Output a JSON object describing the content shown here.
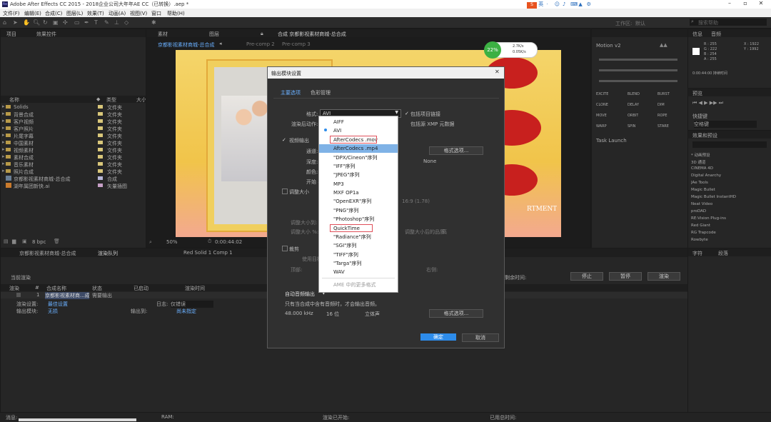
{
  "window": {
    "title": "Adobe After Effects CC 2015 - 2018企业公司大年年AE CC（已转换）.aep *"
  },
  "menu": [
    "文件(F)",
    "编辑(E)",
    "合成(C)",
    "图层(L)",
    "效果(T)",
    "动画(A)",
    "视图(V)",
    "窗口",
    "帮助(H)"
  ],
  "workspace": {
    "label": "工作区:",
    "value": "默认",
    "search_placeholder": "搜索帮助"
  },
  "project_panel": {
    "tab": "项目",
    "tab2": "效果控件",
    "columns": {
      "name": "名称",
      "type": "类型",
      "size": "大小"
    },
    "items": [
      {
        "name": "Solids",
        "type": "文件夹"
      },
      {
        "name": "背景合成",
        "type": "文件夹"
      },
      {
        "name": "客户视频",
        "type": "文件夹"
      },
      {
        "name": "客户照片",
        "type": "文件夹"
      },
      {
        "name": "片尾字幕",
        "type": "文件夹"
      },
      {
        "name": "中国素材",
        "type": "文件夹"
      },
      {
        "name": "视频素材",
        "type": "文件夹"
      },
      {
        "name": "素材合成",
        "type": "文件夹"
      },
      {
        "name": "音乐素材",
        "type": "文件夹"
      },
      {
        "name": "照片合成",
        "type": "文件夹"
      },
      {
        "name": "京都影视素材商城-总合成",
        "type": "合成"
      },
      {
        "name": "湖年属团新快.ai",
        "type": "矢量插图"
      }
    ],
    "bpc": "8 bpc"
  },
  "viewer": {
    "tabs": [
      "素材",
      "图层",
      "合成 京都影视素材商城-总合成"
    ],
    "breadcrumb": [
      "京都影视素材商城-总合成",
      "Pre-comp 2",
      "Pre-comp 3"
    ],
    "zoom": "50%",
    "timecode": "0:00:44:02",
    "overlay_percent": "22%",
    "overlay_up": "2.7K/s",
    "overlay_down": "0.05K/s",
    "text_partial": "RTMENT",
    "text_partial2": "邦"
  },
  "dialog": {
    "title": "输出模块设置",
    "tab_main": "主要选项",
    "tab_color": "色彩管理",
    "format_label": "格式:",
    "format_value": "AVI",
    "include_project_link": "包括项目链接",
    "post_render_label": "渲染后动作:",
    "include_xmp": "包括源 XMP 元数据",
    "video_output": "视频输出",
    "channels_label": "通道:",
    "depth_label": "深度:",
    "color_label": "颜色:",
    "start_label": "开始 #:",
    "format_options": "格式选项...",
    "none_label": "None",
    "resize": "调整大小",
    "crop": "裁剪",
    "use_roi": "使用目标区域",
    "top_label": "顶部:",
    "right_label": "右侧:",
    "resize_to_label": "调整大小到:",
    "resize_pct_label": "调整大小 %:",
    "quality_label": "调整大小后的品质:",
    "quality_value": "高",
    "size_hint": "16:9 (1.78)",
    "audio_auto": "自动音频输出",
    "audio_note": "只有当合成中含有音频时，才会输出音频。",
    "audio_rate": "48.000 kHz",
    "audio_bits": "16 位",
    "audio_channels": "立体声",
    "audio_options": "格式选项...",
    "ok": "确定",
    "cancel": "取消"
  },
  "format_list": {
    "items": [
      "AIFF",
      "AVI",
      "AfterCodecs .mov",
      "AfterCodecs .mp4",
      "\"DPX/Cineon\"序列",
      "\"IFF\"序列",
      "\"JPEG\"序列",
      "MP3",
      "MXF OP1a",
      "\"OpenEXR\"序列",
      "\"PNG\"序列",
      "\"Photoshop\"序列",
      "QuickTime",
      "\"Radiance\"序列",
      "\"SGI\"序列",
      "\"TIFF\"序列",
      "\"Targa\"序列",
      "WAV",
      "AME 中的更多格式"
    ],
    "selected": "AVI",
    "highlighted": "AfterCodecs .mp4",
    "boxed": [
      "AfterCodecs .mov",
      "QuickTime"
    ]
  },
  "render_queue": {
    "tabs": [
      "京都影视素材商城-总合成",
      "渲染队列",
      "Red Solid 1 Comp 1"
    ],
    "current_render": "当前渲染",
    "columns": {
      "render": "渲染",
      "tag": "#",
      "comp": "合成名称",
      "status": "状态",
      "started": "已启动",
      "render_time": "渲染时间"
    },
    "row": {
      "num": "1",
      "comp": "京都影视素材商...成",
      "status": "需要输出"
    },
    "render_settings_label": "渲染设置:",
    "render_settings_value": "最佳设置",
    "output_module_label": "输出模块:",
    "output_module_value": "无损",
    "log_label": "日志:",
    "log_value": "仅错误",
    "output_to_label": "输出到:",
    "output_to_value": "尚未指定",
    "remaining_label": "剩余时间:",
    "buttons": [
      "停止",
      "暂停",
      "渲染"
    ],
    "footer": {
      "message": "消息:",
      "ram": "RAM:",
      "render_start": "渲染已开始:",
      "elapsed": "已用总时间:"
    }
  },
  "info_panel": {
    "tabs": [
      "信息",
      "音频"
    ],
    "r": "R : 255",
    "g": "G : 222",
    "b": "B : 254",
    "a": "A : 255",
    "x": "X : 1922",
    "y": "Y : 1992",
    "timecode": "0:00:44:00 持续时间"
  },
  "preview_panel": {
    "tab": "预览",
    "shortcut_label": "快捷键",
    "shortcut_value": "空格键"
  },
  "effects_panel": {
    "tab": "效果和预设",
    "items": [
      "* 动画预设",
      "3D 通道",
      "CINEMA 4D",
      "Digital Anarchy",
      "JAe Tools",
      "Magic Bullet",
      "Magic Bullet InstantHD",
      "Neat Video",
      "proDAD",
      "RE:Vision Plug-ins",
      "Red Giant",
      "RG Trapcode",
      "Rowbyte"
    ]
  },
  "motion_panel": {
    "tab": "Motion v2",
    "buttons": [
      "EXCITE",
      "BLEND",
      "BURST",
      "CLONE",
      "DELAY",
      "DIM",
      "MOVE",
      "ORBIT",
      "ROPE",
      "WARP",
      "SPIN",
      "STARE"
    ],
    "task_label": "Task Launch"
  },
  "paragraph_panel": {
    "tabs": [
      "字符",
      "段落"
    ]
  },
  "colors": {
    "accent": "#2d8ceb",
    "highlight": "#7fb2e6",
    "box_border": "#e0505a",
    "overlay_green": "#3cb043",
    "lantern_red": "#c8201e",
    "gold": "#e8b84a"
  }
}
